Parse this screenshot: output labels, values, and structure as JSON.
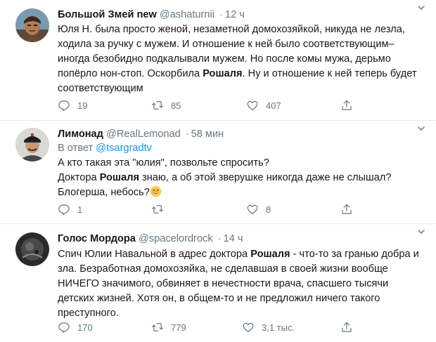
{
  "tweets": [
    {
      "name": "Большой Змей new",
      "handle": "@ashaturnii",
      "dot": "·",
      "time": "12 ч",
      "text_parts": [
        "Юля Н. была просто женой, незаметной домохозяйкой, никуда не лезла, ходила за ручку с мужем. И отношение к ней было соответствующим– иногда безобидно подкалывали мужем. Но после комы мужа, дерьмо попёрло нон-стоп. Оскорбила ",
        "Рошаля",
        ". Ну и отношение к ней теперь будет соответствующим"
      ],
      "replies": "19",
      "retweets": "85",
      "likes": "407"
    },
    {
      "name": "Лимонад",
      "handle": "@RealLemonad",
      "dot": "·",
      "time": "58 мин",
      "reply_prefix": "В ответ",
      "reply_to": "@tsargradtv",
      "text_parts": [
        "А кто такая эта \"юлия\", позвольте спросить?",
        "Доктора ",
        "Рошаля",
        " знаю, а об этой зверушке никогда даже не слышал?",
        "Блогерша, небось?"
      ],
      "replies": "1",
      "retweets": "",
      "likes": "8"
    },
    {
      "name": "Голос Мордора",
      "handle": "@spacelordrock",
      "dot": "·",
      "time": "14 ч",
      "text_parts": [
        "Спич Юлии Навальной в адрес доктора ",
        "Рошаля",
        " - что-то за гранью добра и зла. Безработная домохозяйка, не сделавшая в своей жизни вообще НИЧЕГО значимого, обвиняет в нечестности врача, спасшего тысячи детских жизней. Хотя он, в общем-то и не предложил ничего такого преступного."
      ],
      "replies": "170",
      "retweets": "779",
      "likes": "3,1 тыс."
    }
  ],
  "icons": [
    "caret-down-icon",
    "reply-icon",
    "retweet-icon",
    "like-icon",
    "share-icon",
    "grinning-emoji-icon"
  ],
  "colors": {
    "link": "#1b95e0",
    "muted": "#657786",
    "text": "#14171a",
    "divider": "#e6ecf0"
  }
}
